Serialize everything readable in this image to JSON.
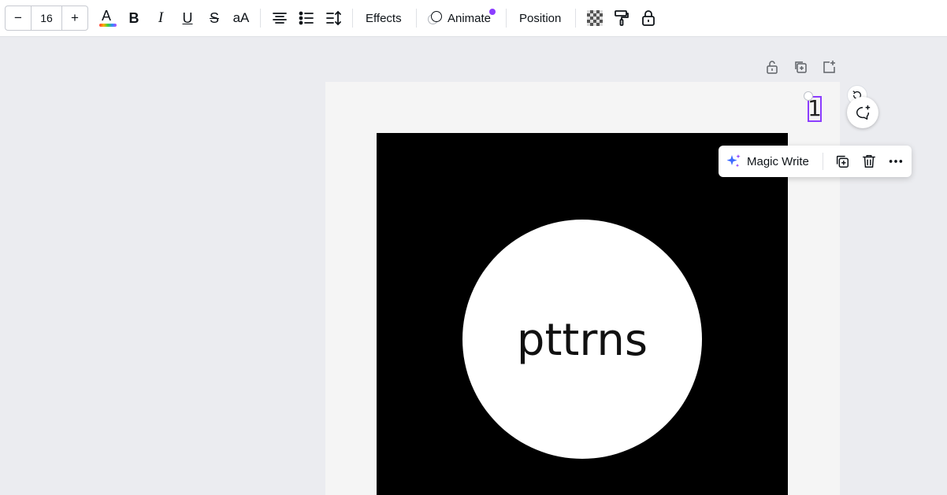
{
  "toolbar": {
    "font_size": {
      "decrement_label": "−",
      "value": "16",
      "increment_label": "+"
    },
    "text_color_letter": "A",
    "bold_label": "B",
    "italic_label": "I",
    "underline_label": "U",
    "strikethrough_label": "S",
    "case_label": "aA",
    "effects_label": "Effects",
    "animate_label": "Animate",
    "position_label": "Position",
    "icons": [
      "text-color-icon",
      "bold-icon",
      "italic-icon",
      "underline-icon",
      "strikethrough-icon",
      "letter-case-icon",
      "align-center-icon",
      "list-icon",
      "spacing-icon",
      "animate-icon",
      "transparency-icon",
      "paint-roller-icon",
      "lock-icon"
    ]
  },
  "page_toolbar": {
    "icons": [
      "unlock-icon",
      "duplicate-page-icon",
      "add-page-icon"
    ]
  },
  "canvas": {
    "logo_text": "pttrns",
    "selected_text": "1"
  },
  "context_menu": {
    "magic_write_label": "Magic Write",
    "icons": [
      "sparkle-icon",
      "duplicate-icon",
      "trash-icon",
      "more-icon"
    ]
  },
  "colors": {
    "accent": "#8b3dff",
    "canvas_bg": "#ebecf0",
    "page_bg": "#f5f5f5",
    "artboard": "#000000",
    "circle": "#ffffff"
  }
}
